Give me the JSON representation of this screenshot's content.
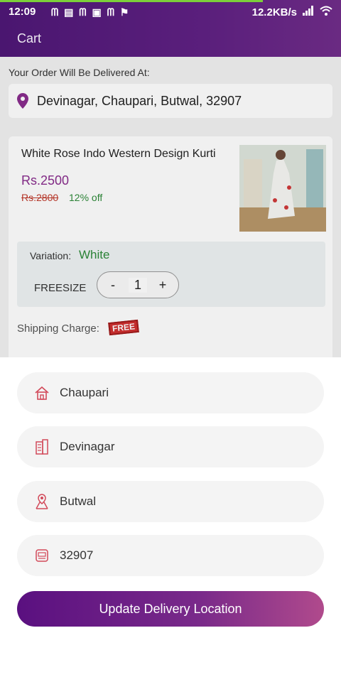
{
  "status_bar": {
    "time": "12:09",
    "network_speed": "12.2KB/s",
    "icons": [
      "m-icon",
      "news-icon",
      "m-icon",
      "gallery-icon",
      "m-icon",
      "flag-icon",
      "signal-icon",
      "wifi-icon"
    ]
  },
  "header": {
    "title": "Cart"
  },
  "delivery": {
    "label": "Your Order Will Be Delivered At:",
    "address": "Devinagar, Chaupari, Butwal, 32907"
  },
  "product": {
    "name": "White Rose Indo Western Design Kurti",
    "price": "Rs.2500",
    "old_price": "Rs.2800",
    "discount": "12% off",
    "variation_label": "Variation:",
    "variation_value": "White",
    "size": "FREESIZE",
    "quantity": "1",
    "minus": "-",
    "plus": "+"
  },
  "shipping": {
    "label": "Shipping Charge:",
    "badge": "FREE"
  },
  "sheet": {
    "fields": [
      {
        "icon": "home-icon",
        "value": "Chaupari"
      },
      {
        "icon": "building-icon",
        "value": "Devinagar"
      },
      {
        "icon": "location-icon",
        "value": "Butwal"
      },
      {
        "icon": "zip-icon",
        "value": "32907"
      }
    ],
    "button_label": "Update Delivery Location"
  },
  "colors": {
    "brand": "#5a1f7c",
    "price": "#8a2d8e",
    "green": "#2e8b3a",
    "icon_accent": "#d24a5a"
  }
}
